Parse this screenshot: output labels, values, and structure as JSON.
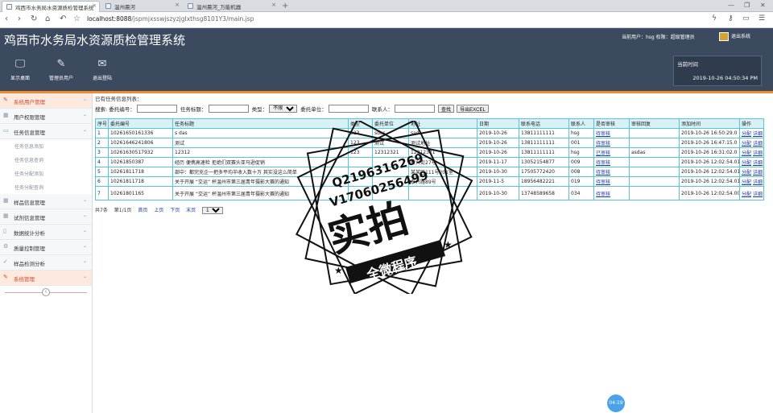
{
  "browser": {
    "tabs": [
      {
        "label": "鸡西市水务局水资源质检管理系统",
        "active": true
      },
      {
        "label": "温州晨河",
        "active": false
      },
      {
        "label": "温州晨河_万能机器",
        "active": false
      }
    ],
    "url_host": "localhost:8088",
    "url_path": "/jspmjxsswjszyzjgIxthsg8101Y3/main.jsp"
  },
  "header": {
    "title": "鸡西市水务局水资源质检管理系统",
    "user_line": "当前用户：hsg  权限：超级管理员",
    "logout_label": "退出系统",
    "nav": [
      {
        "label": "显示桌面",
        "icon": "monitor-icon"
      },
      {
        "label": "管理员用户",
        "icon": "pencil-icon"
      },
      {
        "label": "退出登陆",
        "icon": "mail-icon"
      }
    ],
    "time_label": "当前时间",
    "time_value": "2019-10-26 04:50:34 PM"
  },
  "sidebar": {
    "items": [
      {
        "label": "系统用户管理",
        "active": true
      },
      {
        "label": "用户权限管理",
        "active": false
      },
      {
        "label": "任务信息管理",
        "active": false
      }
    ],
    "subitems": [
      "任务信息添加",
      "任务信息查询",
      "任务分配添加",
      "任务分配查询"
    ],
    "items2": [
      {
        "label": "样品信息管理",
        "active": false
      },
      {
        "label": "试剂信息管理",
        "active": false
      },
      {
        "label": "数据统计分析",
        "active": false
      },
      {
        "label": "质量控制管理",
        "active": false
      },
      {
        "label": "样品检测分析",
        "active": false
      },
      {
        "label": "系统管理",
        "active": true
      }
    ]
  },
  "main": {
    "heading": "已有任务信息列表：",
    "search": {
      "entrust_no_label": "搜索: 委托编号：",
      "task_title_label": "任务标题：",
      "type_label": "类型：",
      "type_selected": "不限",
      "entrust_unit_label": "委托单位：",
      "contact_label": "联系人：",
      "search_button": "查找",
      "export_button": "导出EXCEL"
    },
    "columns": [
      "序号",
      "委托编号",
      "任务标题",
      "类型",
      "委托单位",
      "地址",
      "日期",
      "联系电话",
      "联系人",
      "是否审核",
      "审核回复",
      "添加时间",
      "操作"
    ],
    "rows": [
      [
        "1",
        "10261650161336",
        "s das",
        "123",
        "sdas",
        "sad",
        "2019-10-26",
        "13811111111",
        "hsg",
        "待审核",
        "",
        "2019-10-26 16:50:29.0"
      ],
      [
        "2",
        "10261646241806",
        "测试",
        "123",
        "测试",
        "测试地址",
        "2019-10-26",
        "13811111111",
        "001",
        "待审核",
        "",
        "2019-10-26 16:47:15.0"
      ],
      [
        "3",
        "10261630517932",
        "12312",
        "123",
        "12312321",
        "12312321",
        "2019-10-26",
        "13811111111",
        "hsg",
        "已审核",
        "asdas",
        "2019-10-26 16:31:02.0"
      ],
      [
        "4",
        "10261850387",
        "经历 便携高速检 拒绝们双赛头亚马逊促销",
        "",
        "",
        "新兴街27号",
        "2019-11-17",
        "13052154877",
        "009",
        "待审核",
        "",
        "2019-10-26 12:02:54.01"
      ],
      [
        "5",
        "10261811718",
        "部中：都完充企一把多平均半收入数十万 其实没这么简单",
        "",
        "",
        "某某区111号201室",
        "2019-10-30",
        "17505772420",
        "008",
        "待审核",
        "",
        "2019-10-26 12:02:54.01"
      ],
      [
        "6",
        "10261811718",
        "关于开展 “交运” 杯温州市第三届青年摄影大赛的通知",
        "",
        "",
        "泰兴路89号",
        "2019-11-5",
        "18956482221",
        "019",
        "待审核",
        "",
        "2019-10-26 12:02:54.01"
      ],
      [
        "7",
        "10261801165",
        "关于开展 “交运” 杯温州市第三届青年摄影大赛的通知",
        "",
        "",
        "",
        "2019-10-30",
        "13748589658",
        "034",
        "待审核",
        "",
        "2019-10-26 12:02:54.007"
      ]
    ],
    "op_assign": "分配",
    "op_detail": "详细",
    "pager": {
      "total": "共7条",
      "page": "第1/1页",
      "first": "首页",
      "prev": "上页",
      "next": "下页",
      "last": "末页",
      "page_select": "1"
    }
  },
  "watermark": {
    "line1": "Q2196316269",
    "line2": "V17060256499",
    "big": "实拍",
    "banner": "全微程序"
  },
  "clock_badge": "04:19"
}
